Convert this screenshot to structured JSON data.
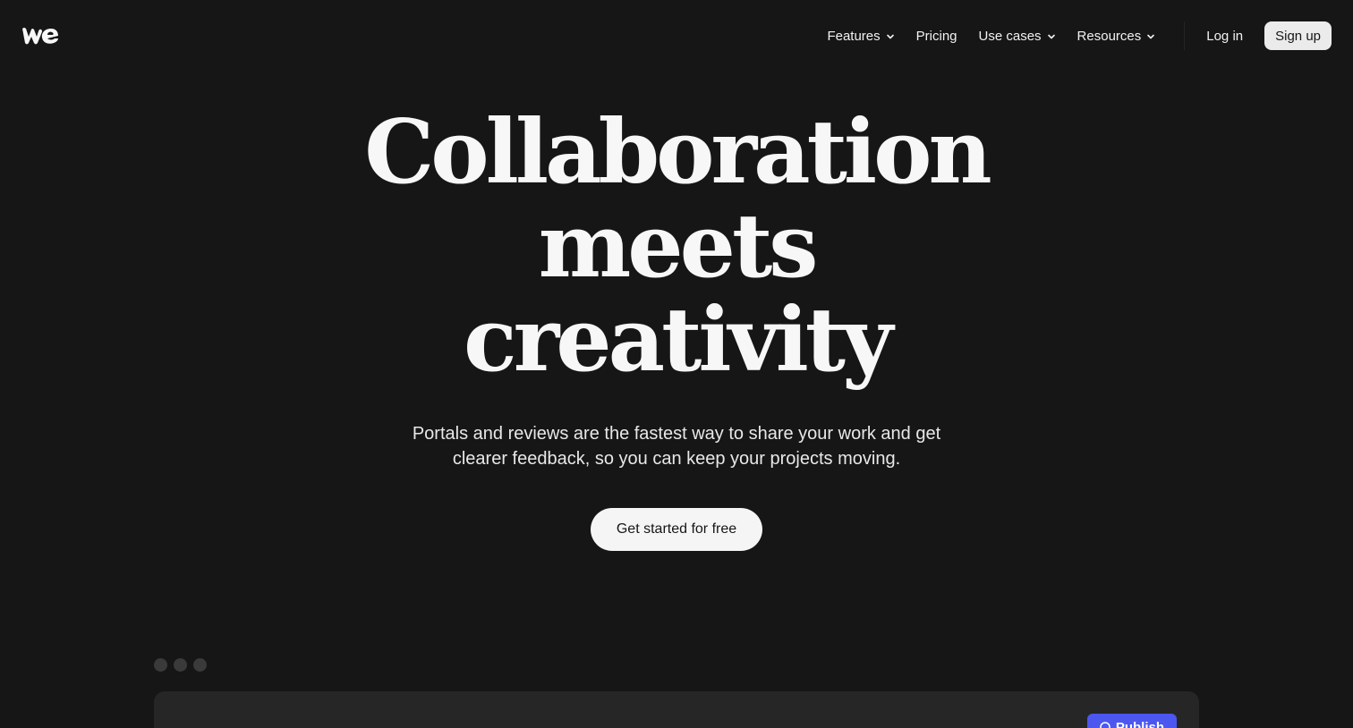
{
  "nav": {
    "features": "Features",
    "pricing": "Pricing",
    "use_cases": "Use cases",
    "resources": "Resources",
    "login": "Log in",
    "signup": "Sign up"
  },
  "hero": {
    "title_line1": "Collaboration",
    "title_line2": "meets",
    "title_line3": "creativity",
    "subtitle_line1": "Portals and reviews are the fastest way to share your work and get",
    "subtitle_line2": "clearer feedback, so you can keep your projects moving.",
    "cta": "Get started for free"
  },
  "preview": {
    "publish_label": "Publish"
  },
  "colors": {
    "background": "#161616",
    "publish_accent": "#4c57f0"
  }
}
